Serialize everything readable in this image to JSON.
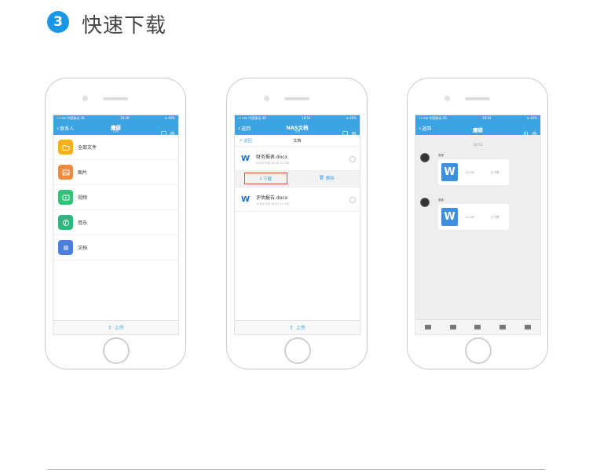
{
  "header": {
    "step": "3",
    "title": "快速下载"
  },
  "colors": {
    "accent": "#3da4e3",
    "highlight": "#e24a3b"
  },
  "phone1": {
    "status": {
      "carrier": "•••oo 中国移动 4G",
      "time": "18:49",
      "battery": "⊕ 49%"
    },
    "nav": {
      "back": "联系人",
      "title": "魔碟",
      "subtitle": "在线"
    },
    "items": [
      {
        "label": "全部文件",
        "icon": "folder-icon",
        "color": "#f5b021"
      },
      {
        "label": "图片",
        "icon": "image-icon",
        "color": "#f08a3c"
      },
      {
        "label": "视频",
        "icon": "video-icon",
        "color": "#34c27a"
      },
      {
        "label": "音乐",
        "icon": "music-icon",
        "color": "#2fb67e"
      },
      {
        "label": "文档",
        "icon": "document-icon",
        "color": "#4a7fe0"
      }
    ],
    "footer": "上传"
  },
  "phone2": {
    "status": {
      "carrier": "•••oo 中国移动 4G",
      "time": "18:54",
      "battery": "⊕ 46%"
    },
    "nav": {
      "back": "返回",
      "title": "NAS文档",
      "subtitle": "在线"
    },
    "crumb": {
      "back": "返回",
      "current": "文档"
    },
    "files": [
      {
        "name": "财务报表.docx",
        "meta": "2016/7/26  18:33  11.25K"
      },
      {
        "name": "评估报告.docx",
        "meta": "2016/7/26  18:33  11.25K"
      }
    ],
    "actions": {
      "download": "下载",
      "delete": "删除"
    },
    "footer": "上传"
  },
  "phone3": {
    "status": {
      "carrier": "•••oo 中国移动 4G",
      "time": "18:54",
      "battery": "⊕ 46%"
    },
    "nav": {
      "back": "返回",
      "title": "魔碟"
    },
    "chat_time": "18:53",
    "messages": [
      {
        "sender": "魔碟",
        "size": "11.25K",
        "state": "已下载"
      },
      {
        "sender": "魔碟",
        "size": "11.25K",
        "state": "已下载"
      }
    ]
  }
}
